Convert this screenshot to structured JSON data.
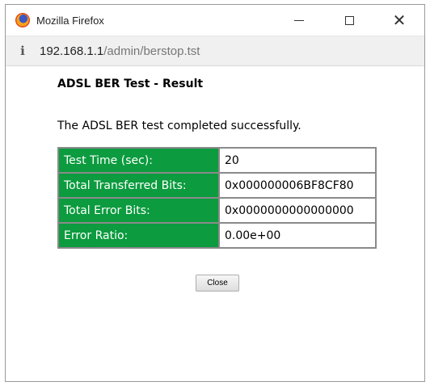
{
  "window": {
    "title": "Mozilla Firefox",
    "controls": {
      "minimize": "—",
      "maximize": "☐",
      "close": "✕"
    }
  },
  "urlbar": {
    "host": "192.168.1.1",
    "path": "/admin/berstop.tst"
  },
  "page": {
    "heading": "ADSL BER Test - Result",
    "message": "The ADSL BER test completed successfully.",
    "results": [
      {
        "label": "Test Time (sec):",
        "value": "20"
      },
      {
        "label": "Total Transferred Bits:",
        "value": "0x000000006BF8CF80"
      },
      {
        "label": "Total Error Bits:",
        "value": "0x0000000000000000"
      },
      {
        "label": "Error Ratio:",
        "value": "0.00e+00"
      }
    ],
    "close_label": "Close"
  },
  "colors": {
    "label_bg": "#0c9b3f",
    "label_text": "#ffffff"
  },
  "icons": {
    "app": "firefox-logo-icon",
    "site_info": "site-info-icon"
  }
}
